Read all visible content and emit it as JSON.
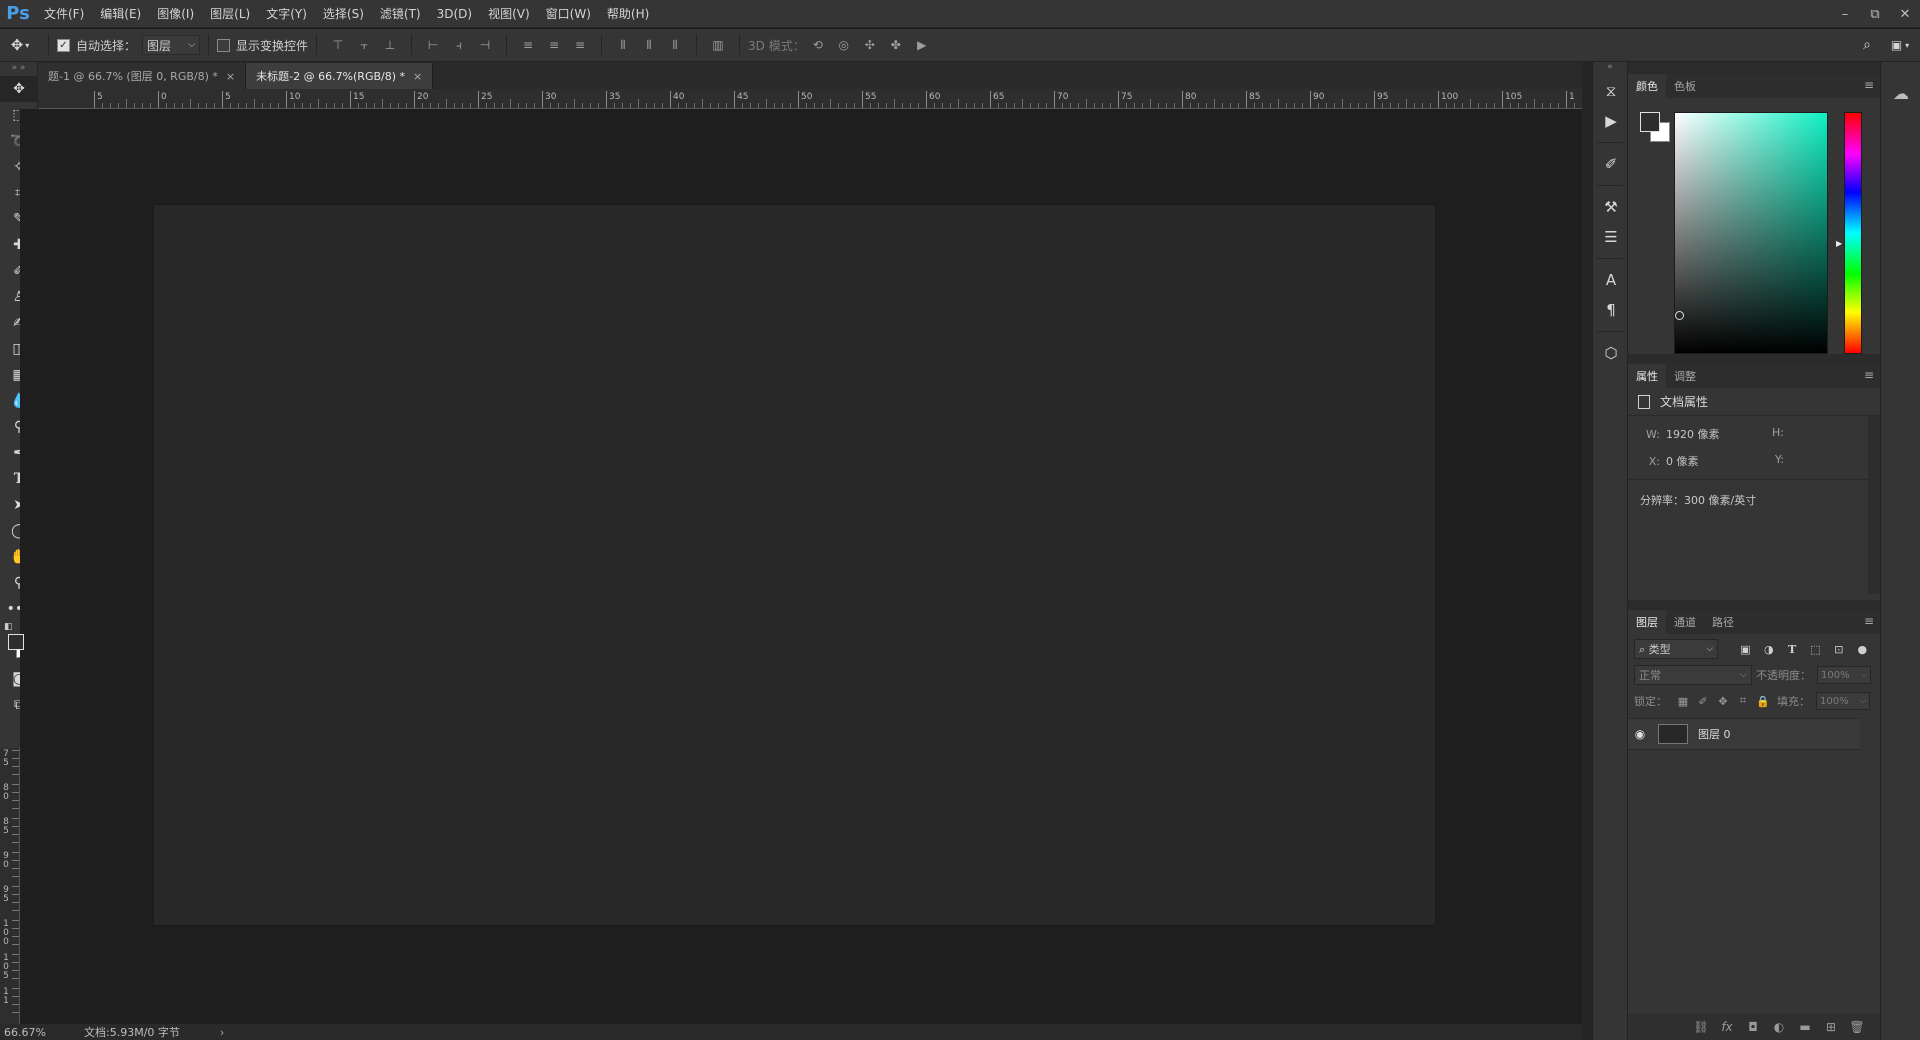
{
  "app": {
    "logo": "Ps"
  },
  "menu": [
    "文件(F)",
    "编辑(E)",
    "图像(I)",
    "图层(L)",
    "文字(Y)",
    "选择(S)",
    "滤镜(T)",
    "3D(D)",
    "视图(V)",
    "窗口(W)",
    "帮助(H)"
  ],
  "window_controls": {
    "minimize": "–",
    "restore": "⧉",
    "close": "✕"
  },
  "options": {
    "auto_select_label": "自动选择：",
    "auto_select_value": "图层",
    "show_transform_label": "显示变换控件",
    "mode_3d_label": "3D 模式：",
    "select_arrow": "⌵"
  },
  "tabs": [
    {
      "label": "题-1 @ 66.7% (图层 0, RGB/8) *",
      "close": "×"
    },
    {
      "label": "未标题-2 @ 66.7%(RGB/8) *",
      "close": "×"
    }
  ],
  "ruler": {
    "h_labels": [
      "5",
      "0",
      "5",
      "10",
      "15",
      "20",
      "25",
      "30",
      "35",
      "40",
      "45",
      "50",
      "55",
      "60",
      "65",
      "70",
      "75",
      "80",
      "85",
      "90",
      "95",
      "100",
      "105",
      "1"
    ],
    "v_labels": [
      [
        "7",
        "5"
      ],
      [
        "8",
        "0"
      ],
      [
        "8",
        "5"
      ],
      [
        "9",
        "0"
      ],
      [
        "9",
        "5"
      ],
      [
        "1",
        "0",
        "0"
      ],
      [
        "1",
        "0",
        "5"
      ],
      [
        "1",
        "1"
      ]
    ]
  },
  "status": {
    "zoom": "66.67%",
    "doc_info": "文档:5.93M/0 字节",
    "arrow": "›"
  },
  "color_panel": {
    "tabs": [
      "颜色",
      "色板"
    ],
    "menu": "≡"
  },
  "props_panel": {
    "tabs": [
      "属性",
      "调整"
    ],
    "menu": "≡",
    "header": "文档属性",
    "w_label": "W:",
    "w_value": "1920 像素",
    "h_label": "H:",
    "h_value": "",
    "x_label": "X:",
    "x_value": "0 像素",
    "y_label": "Y:",
    "y_value": "",
    "resolution": "分辨率：300 像素/英寸"
  },
  "layers_panel": {
    "tabs": [
      "图层",
      "通道",
      "路径"
    ],
    "menu": "≡",
    "filter_label": "⌕ 类型",
    "blend_mode": "正常",
    "opacity_label": "不透明度：",
    "opacity_value": "100%",
    "lock_label": "锁定：",
    "fill_label": "填充：",
    "fill_value": "100%",
    "layers": [
      {
        "name": "图层 0"
      }
    ]
  },
  "toolbar_icons": [
    "move-tool-icon",
    "marquee-tool-icon",
    "lasso-tool-icon",
    "magic-wand-icon",
    "crop-tool-icon",
    "eyedropper-icon",
    "healing-brush-icon",
    "brush-tool-icon",
    "clone-stamp-icon",
    "history-brush-icon",
    "eraser-icon",
    "gradient-tool-icon",
    "blur-tool-icon",
    "dodge-tool-icon",
    "pen-tool-icon",
    "type-tool-icon",
    "path-select-icon",
    "ellipse-tool-icon",
    "hand-tool-icon",
    "zoom-tool-icon",
    "more-tools-icon"
  ]
}
